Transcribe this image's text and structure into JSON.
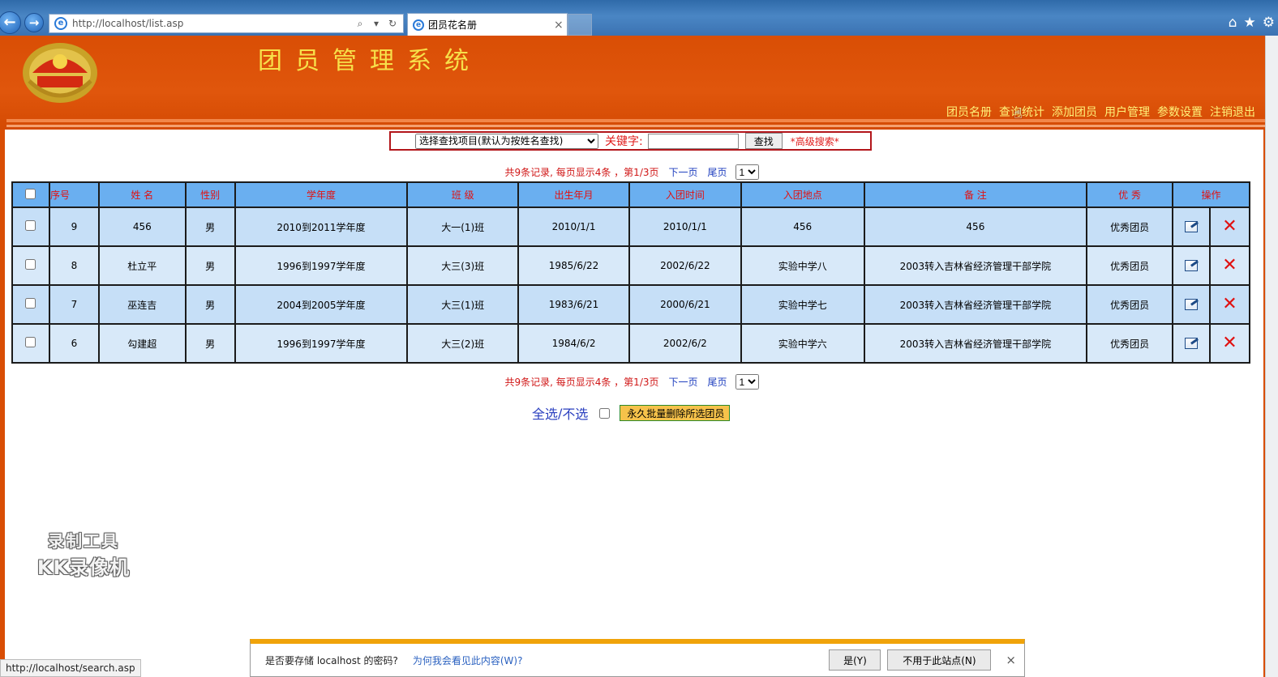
{
  "browser": {
    "url": "http://localhost/list.asp",
    "tab_title": "团员花名册",
    "status_url": "http://localhost/search.asp"
  },
  "header": {
    "title": "团员管理系统",
    "nav": [
      "团员名册",
      "查询统计",
      "添加团员",
      "用户管理",
      "参数设置",
      "注销退出"
    ]
  },
  "search": {
    "select_default": "选择查找项目(默认为按姓名查找)",
    "keyword_label": "关键字:",
    "button": "查找",
    "advanced": "*高级搜索*"
  },
  "pager": {
    "summary": "共9条记录, 每页显示4条 ，第1/3页",
    "next": "下一页",
    "last": "尾页",
    "page_option": "1"
  },
  "table": {
    "headers": [
      "序号",
      "姓 名",
      "性别",
      "学年度",
      "班 级",
      "出生年月",
      "入团时间",
      "入团地点",
      "备 注",
      "优 秀",
      "操作"
    ],
    "rows": [
      {
        "id": "9",
        "name": "456",
        "gender": "男",
        "year": "2010到2011学年度",
        "class": "大一(1)班",
        "birth": "2010/1/1",
        "join_date": "2010/1/1",
        "join_place": "456",
        "note": "456",
        "honor": "优秀团员"
      },
      {
        "id": "8",
        "name": "杜立平",
        "gender": "男",
        "year": "1996到1997学年度",
        "class": "大三(3)班",
        "birth": "1985/6/22",
        "join_date": "2002/6/22",
        "join_place": "实验中学八",
        "note": "2003转入吉林省经济管理干部学院",
        "honor": "优秀团员"
      },
      {
        "id": "7",
        "name": "巫连吉",
        "gender": "男",
        "year": "2004到2005学年度",
        "class": "大三(1)班",
        "birth": "1983/6/21",
        "join_date": "2000/6/21",
        "join_place": "实验中学七",
        "note": "2003转入吉林省经济管理干部学院",
        "honor": "优秀团员"
      },
      {
        "id": "6",
        "name": "勾建超",
        "gender": "男",
        "year": "1996到1997学年度",
        "class": "大三(2)班",
        "birth": "1984/6/2",
        "join_date": "2002/6/2",
        "join_place": "实验中学六",
        "note": "2003转入吉林省经济管理干部学院",
        "honor": "优秀团员"
      }
    ]
  },
  "bulk": {
    "select_all": "全选",
    "separator": "/",
    "select_none": "不选",
    "delete_button": "永久批量删除所选团员"
  },
  "watermark": {
    "line1": "录制工具",
    "line2": "KK录像机"
  },
  "password_prompt": {
    "question": "是否要存储 localhost 的密码?",
    "why_link": "为何我会看见此内容(W)?",
    "yes": "是(Y)",
    "no": "不用于此站点(N)"
  },
  "colors": {
    "banner": "#d94e05",
    "title_text": "#f7e04a",
    "table_header": "#6aaff0",
    "table_row": "#c6dff7"
  }
}
